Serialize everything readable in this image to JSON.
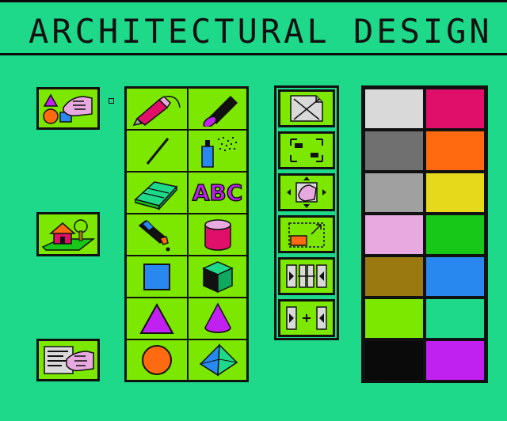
{
  "title": "ARCHITECTURAL DESIGN",
  "tools": {
    "abc_label": "ABC"
  },
  "palette": [
    [
      "#d9d9d9",
      "#e0106a"
    ],
    [
      "#707070",
      "#ff6a10"
    ],
    [
      "#a0a0a0",
      "#e6d81a"
    ],
    [
      "#e8a8e0",
      "#18c818"
    ],
    [
      "#9a7a10",
      "#2888f0"
    ],
    [
      "#7ce800",
      "#1ed98a"
    ],
    [
      "#0a0a0a",
      "#c020f0"
    ]
  ],
  "colors": {
    "background": "#1ed98a",
    "button": "#7ce800",
    "outline": "#111111"
  }
}
